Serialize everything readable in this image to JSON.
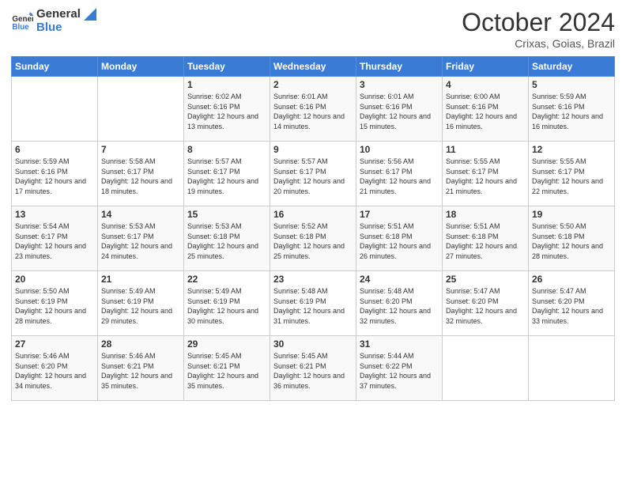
{
  "header": {
    "logo_line1": "General",
    "logo_line2": "Blue",
    "month": "October 2024",
    "location": "Crixas, Goias, Brazil"
  },
  "weekdays": [
    "Sunday",
    "Monday",
    "Tuesday",
    "Wednesday",
    "Thursday",
    "Friday",
    "Saturday"
  ],
  "weeks": [
    [
      {
        "day": "",
        "sunrise": "",
        "sunset": "",
        "daylight": ""
      },
      {
        "day": "",
        "sunrise": "",
        "sunset": "",
        "daylight": ""
      },
      {
        "day": "1",
        "sunrise": "Sunrise: 6:02 AM",
        "sunset": "Sunset: 6:16 PM",
        "daylight": "Daylight: 12 hours and 13 minutes."
      },
      {
        "day": "2",
        "sunrise": "Sunrise: 6:01 AM",
        "sunset": "Sunset: 6:16 PM",
        "daylight": "Daylight: 12 hours and 14 minutes."
      },
      {
        "day": "3",
        "sunrise": "Sunrise: 6:01 AM",
        "sunset": "Sunset: 6:16 PM",
        "daylight": "Daylight: 12 hours and 15 minutes."
      },
      {
        "day": "4",
        "sunrise": "Sunrise: 6:00 AM",
        "sunset": "Sunset: 6:16 PM",
        "daylight": "Daylight: 12 hours and 16 minutes."
      },
      {
        "day": "5",
        "sunrise": "Sunrise: 5:59 AM",
        "sunset": "Sunset: 6:16 PM",
        "daylight": "Daylight: 12 hours and 16 minutes."
      }
    ],
    [
      {
        "day": "6",
        "sunrise": "Sunrise: 5:59 AM",
        "sunset": "Sunset: 6:16 PM",
        "daylight": "Daylight: 12 hours and 17 minutes."
      },
      {
        "day": "7",
        "sunrise": "Sunrise: 5:58 AM",
        "sunset": "Sunset: 6:17 PM",
        "daylight": "Daylight: 12 hours and 18 minutes."
      },
      {
        "day": "8",
        "sunrise": "Sunrise: 5:57 AM",
        "sunset": "Sunset: 6:17 PM",
        "daylight": "Daylight: 12 hours and 19 minutes."
      },
      {
        "day": "9",
        "sunrise": "Sunrise: 5:57 AM",
        "sunset": "Sunset: 6:17 PM",
        "daylight": "Daylight: 12 hours and 20 minutes."
      },
      {
        "day": "10",
        "sunrise": "Sunrise: 5:56 AM",
        "sunset": "Sunset: 6:17 PM",
        "daylight": "Daylight: 12 hours and 21 minutes."
      },
      {
        "day": "11",
        "sunrise": "Sunrise: 5:55 AM",
        "sunset": "Sunset: 6:17 PM",
        "daylight": "Daylight: 12 hours and 21 minutes."
      },
      {
        "day": "12",
        "sunrise": "Sunrise: 5:55 AM",
        "sunset": "Sunset: 6:17 PM",
        "daylight": "Daylight: 12 hours and 22 minutes."
      }
    ],
    [
      {
        "day": "13",
        "sunrise": "Sunrise: 5:54 AM",
        "sunset": "Sunset: 6:17 PM",
        "daylight": "Daylight: 12 hours and 23 minutes."
      },
      {
        "day": "14",
        "sunrise": "Sunrise: 5:53 AM",
        "sunset": "Sunset: 6:17 PM",
        "daylight": "Daylight: 12 hours and 24 minutes."
      },
      {
        "day": "15",
        "sunrise": "Sunrise: 5:53 AM",
        "sunset": "Sunset: 6:18 PM",
        "daylight": "Daylight: 12 hours and 25 minutes."
      },
      {
        "day": "16",
        "sunrise": "Sunrise: 5:52 AM",
        "sunset": "Sunset: 6:18 PM",
        "daylight": "Daylight: 12 hours and 25 minutes."
      },
      {
        "day": "17",
        "sunrise": "Sunrise: 5:51 AM",
        "sunset": "Sunset: 6:18 PM",
        "daylight": "Daylight: 12 hours and 26 minutes."
      },
      {
        "day": "18",
        "sunrise": "Sunrise: 5:51 AM",
        "sunset": "Sunset: 6:18 PM",
        "daylight": "Daylight: 12 hours and 27 minutes."
      },
      {
        "day": "19",
        "sunrise": "Sunrise: 5:50 AM",
        "sunset": "Sunset: 6:18 PM",
        "daylight": "Daylight: 12 hours and 28 minutes."
      }
    ],
    [
      {
        "day": "20",
        "sunrise": "Sunrise: 5:50 AM",
        "sunset": "Sunset: 6:19 PM",
        "daylight": "Daylight: 12 hours and 28 minutes."
      },
      {
        "day": "21",
        "sunrise": "Sunrise: 5:49 AM",
        "sunset": "Sunset: 6:19 PM",
        "daylight": "Daylight: 12 hours and 29 minutes."
      },
      {
        "day": "22",
        "sunrise": "Sunrise: 5:49 AM",
        "sunset": "Sunset: 6:19 PM",
        "daylight": "Daylight: 12 hours and 30 minutes."
      },
      {
        "day": "23",
        "sunrise": "Sunrise: 5:48 AM",
        "sunset": "Sunset: 6:19 PM",
        "daylight": "Daylight: 12 hours and 31 minutes."
      },
      {
        "day": "24",
        "sunrise": "Sunrise: 5:48 AM",
        "sunset": "Sunset: 6:20 PM",
        "daylight": "Daylight: 12 hours and 32 minutes."
      },
      {
        "day": "25",
        "sunrise": "Sunrise: 5:47 AM",
        "sunset": "Sunset: 6:20 PM",
        "daylight": "Daylight: 12 hours and 32 minutes."
      },
      {
        "day": "26",
        "sunrise": "Sunrise: 5:47 AM",
        "sunset": "Sunset: 6:20 PM",
        "daylight": "Daylight: 12 hours and 33 minutes."
      }
    ],
    [
      {
        "day": "27",
        "sunrise": "Sunrise: 5:46 AM",
        "sunset": "Sunset: 6:20 PM",
        "daylight": "Daylight: 12 hours and 34 minutes."
      },
      {
        "day": "28",
        "sunrise": "Sunrise: 5:46 AM",
        "sunset": "Sunset: 6:21 PM",
        "daylight": "Daylight: 12 hours and 35 minutes."
      },
      {
        "day": "29",
        "sunrise": "Sunrise: 5:45 AM",
        "sunset": "Sunset: 6:21 PM",
        "daylight": "Daylight: 12 hours and 35 minutes."
      },
      {
        "day": "30",
        "sunrise": "Sunrise: 5:45 AM",
        "sunset": "Sunset: 6:21 PM",
        "daylight": "Daylight: 12 hours and 36 minutes."
      },
      {
        "day": "31",
        "sunrise": "Sunrise: 5:44 AM",
        "sunset": "Sunset: 6:22 PM",
        "daylight": "Daylight: 12 hours and 37 minutes."
      },
      {
        "day": "",
        "sunrise": "",
        "sunset": "",
        "daylight": ""
      },
      {
        "day": "",
        "sunrise": "",
        "sunset": "",
        "daylight": ""
      }
    ]
  ]
}
